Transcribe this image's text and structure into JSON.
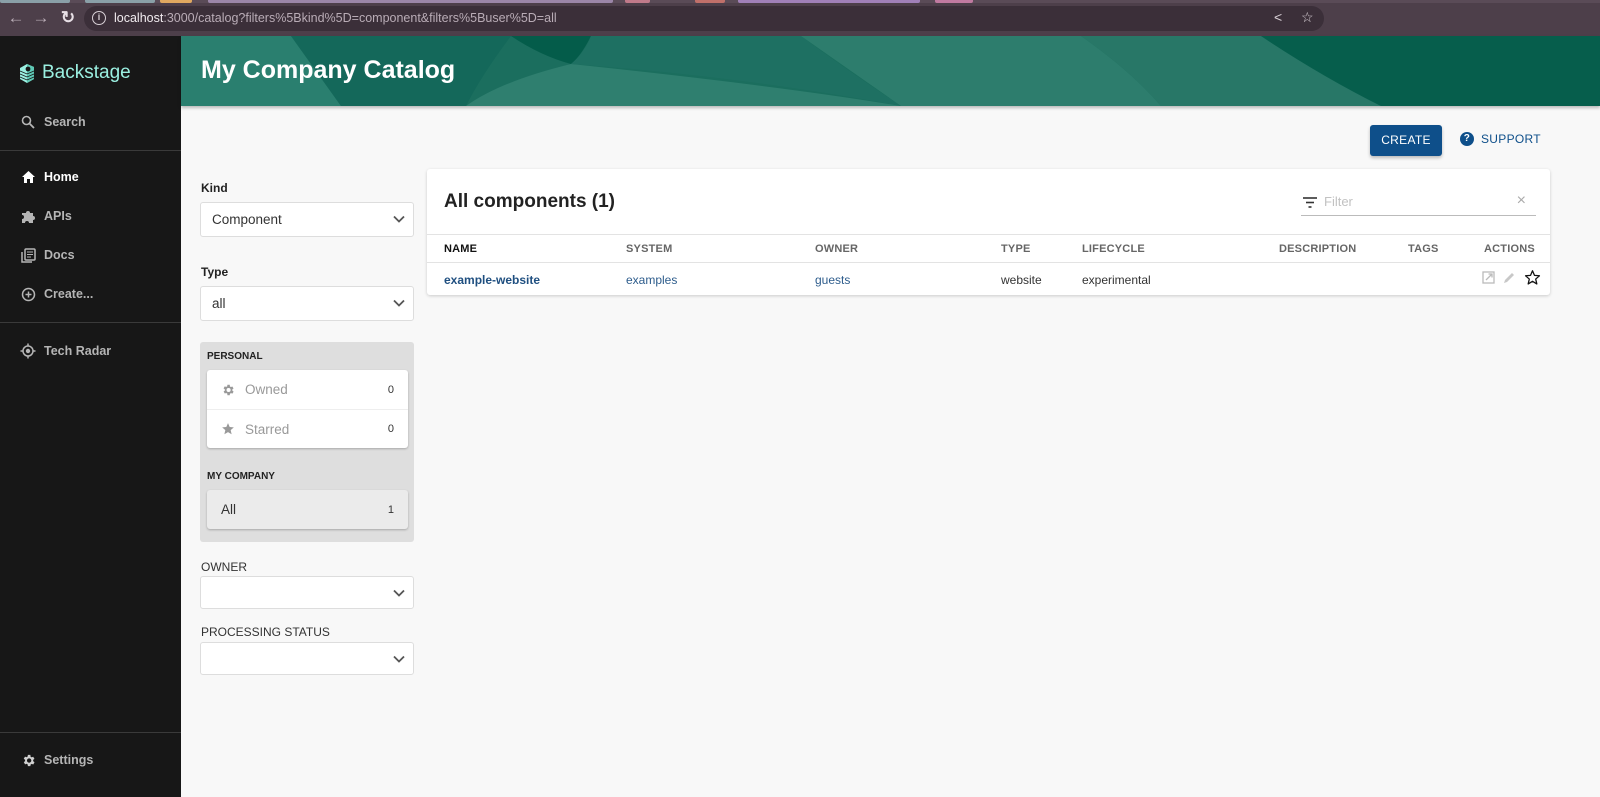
{
  "browser": {
    "url_host": "localhost",
    "url_rest": ":3000/catalog?filters%5Bkind%5D=component&filters%5Buser%5D=all",
    "back_icon": "arrow-left-icon",
    "forward_icon": "arrow-right-icon",
    "reload_icon": "reload-icon",
    "share_icon": "share-icon",
    "bookmark_icon": "star-outline-icon"
  },
  "sidebar": {
    "logo_text": "Backstage",
    "search_label": "Search",
    "items": [
      {
        "label": "Home",
        "icon": "home-icon",
        "active": true
      },
      {
        "label": "APIs",
        "icon": "puzzle-icon"
      },
      {
        "label": "Docs",
        "icon": "docs-icon"
      },
      {
        "label": "Create...",
        "icon": "add-circle-icon"
      }
    ],
    "tech_radar_label": "Tech Radar",
    "settings_label": "Settings"
  },
  "header": {
    "title": "My Company Catalog"
  },
  "actions": {
    "create_label": "CREATE",
    "support_label": "SUPPORT"
  },
  "filters": {
    "kind_label": "Kind",
    "kind_value": "Component",
    "type_label": "Type",
    "type_value": "all",
    "personal_title": "PERSONAL",
    "owned_label": "Owned",
    "owned_count": "0",
    "starred_label": "Starred",
    "starred_count": "0",
    "company_title": "MY COMPANY",
    "all_label": "All",
    "all_count": "1",
    "owner_label": "OWNER",
    "owner_value": "",
    "processing_label": "PROCESSING STATUS",
    "processing_value": ""
  },
  "table": {
    "title": "All components (1)",
    "filter_placeholder": "Filter",
    "columns": [
      "NAME",
      "SYSTEM",
      "OWNER",
      "TYPE",
      "LIFECYCLE",
      "DESCRIPTION",
      "TAGS",
      "ACTIONS"
    ],
    "rows": [
      {
        "name": "example-website",
        "system": "examples",
        "owner": "guests",
        "type": "website",
        "lifecycle": "experimental",
        "description": "",
        "tags": ""
      }
    ]
  },
  "colors": {
    "brand_green": "#1b6e5e",
    "logo_teal": "#9bf0e1",
    "primary_blue": "#0e4f8a",
    "sidebar_bg": "#171717"
  }
}
